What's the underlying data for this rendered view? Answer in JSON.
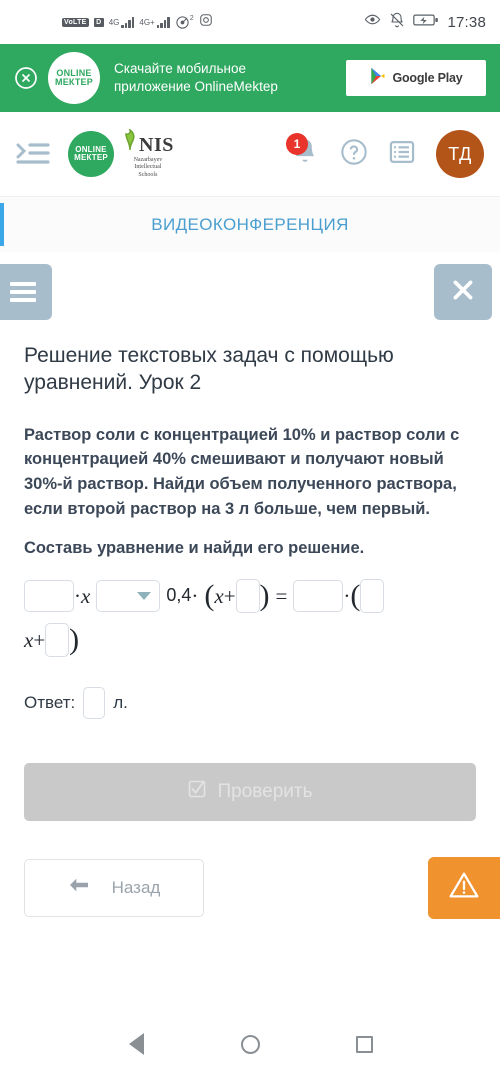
{
  "status_bar": {
    "volte": "VoLTE",
    "sim": "D",
    "network_1": "4G",
    "network_2": "4G+",
    "hotspot_superscript": "2",
    "time": "17:38",
    "icons": [
      "eye-icon",
      "bell-muted-icon",
      "battery-charging-icon"
    ]
  },
  "promo_banner": {
    "close_label": "×",
    "logo_line1": "ONLINE",
    "logo_line2": "МЕКТЕР",
    "text_line1": "Скачайте мобильное",
    "text_line2": "приложение OnlineMektep",
    "store_button": "Google Play",
    "background_color": "#2fa860"
  },
  "topnav": {
    "menu_toggle": "menu-toggle-icon",
    "om_logo_line1": "ONLINE",
    "om_logo_line2": "МЕКТЕР",
    "nis_logo_main": "NIS",
    "nis_logo_sub_line1": "Nazarbayev",
    "nis_logo_sub_line2": "Intellectual",
    "nis_logo_sub_line3": "Schools",
    "notification_count": "1",
    "help_label": "?",
    "avatar_initials": "ТД",
    "avatar_color": "#b35418"
  },
  "videoconference": {
    "label": "ВИДЕОКОНФЕРЕНЦИЯ",
    "accent_color": "#3ba7e8"
  },
  "panel_controls": {
    "menu_button": "hamburger-icon",
    "close_button": "×"
  },
  "lesson": {
    "title": "Решение текстовых задач с помощью уравнений. Урок 2",
    "problem": "Раствор соли с концентрацией 10% и раствор соли с концентрацией 40% смешивают и получают новый 30%-й раствор. Найди объем полученного раствора, если второй раствор на 3 л больше, чем первый.",
    "instruction": "Составь уравнение и найди его решение."
  },
  "equation": {
    "box1_value": "",
    "mult1": "·",
    "var1": "x",
    "select_value": "",
    "coefficient": "0,4",
    "mult2": "·",
    "open_paren1": "(",
    "var2": "x",
    "plus1": "+",
    "box2_value": "",
    "close_paren1": ")",
    "equals": "=",
    "box3_value": "",
    "mult3": "·",
    "open_paren2": "(",
    "box4_value": "",
    "var3": "x",
    "plus2": "+",
    "box5_value": "",
    "close_paren2": ")"
  },
  "answer": {
    "label": "Ответ:",
    "value": "",
    "unit": "л."
  },
  "check_button": {
    "label": "Проверить",
    "icon": "checkbox-icon",
    "enabled": false,
    "color": "#c9c9c9"
  },
  "bottom": {
    "back_label": "Назад",
    "back_icon": "arrow-left-icon",
    "warn_icon": "warning-triangle-icon",
    "warn_color": "#f0932f"
  },
  "android_nav": {
    "back": "back-triangle-icon",
    "home": "home-circle-icon",
    "recents": "recents-square-icon"
  }
}
